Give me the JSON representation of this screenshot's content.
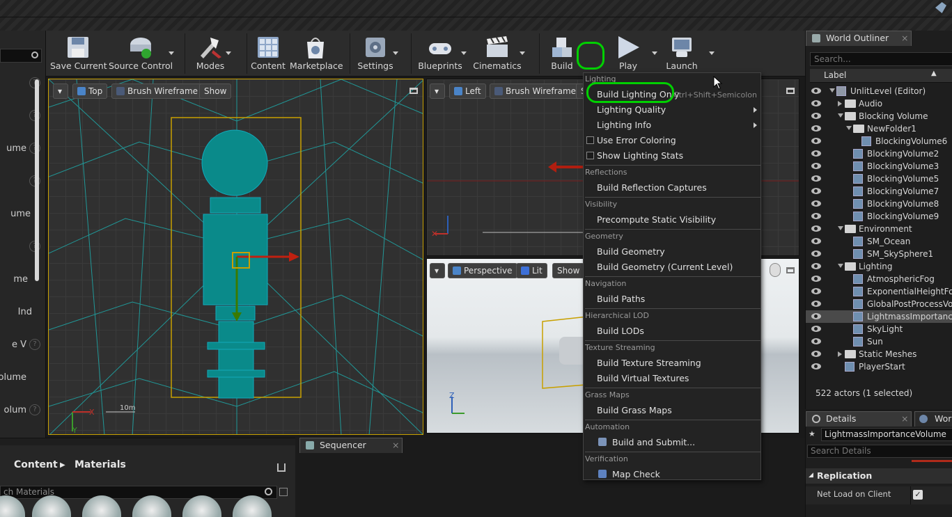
{
  "toolbar": {
    "save_current": "Save Current",
    "source_control": "Source Control",
    "modes": "Modes",
    "content": "Content",
    "marketplace": "Marketplace",
    "settings": "Settings",
    "blueprints": "Blueprints",
    "cinematics": "Cinematics",
    "build": "Build",
    "play": "Play",
    "launch": "Launch"
  },
  "left_panel": {
    "rows": [
      "ume",
      "ume",
      "me",
      "Ind",
      "e V",
      "Volume",
      "olum"
    ]
  },
  "viewport_top": {
    "view": "Top",
    "mode": "Brush Wireframe",
    "show": "Show",
    "scale": "10m"
  },
  "viewport_left": {
    "view": "Left",
    "mode": "Brush Wireframe",
    "show": "S"
  },
  "viewport_persp": {
    "view": "Perspective",
    "mode": "Lit",
    "show": "Show"
  },
  "axes": {
    "x": "X",
    "y": "Y",
    "z": "Z"
  },
  "build_menu": {
    "sections": [
      {
        "header": "Lighting",
        "items": [
          {
            "label": "Build Lighting Only",
            "shortcut": "Ctrl+Shift+Semicolon"
          },
          {
            "label": "Lighting Quality",
            "submenu": true
          },
          {
            "label": "Lighting Info",
            "submenu": true
          },
          {
            "label": "Use Error Coloring",
            "checkbox": true
          },
          {
            "label": "Show Lighting Stats",
            "checkbox": true
          }
        ]
      },
      {
        "header": "Reflections",
        "items": [
          {
            "label": "Build Reflection Captures"
          }
        ]
      },
      {
        "header": "Visibility",
        "items": [
          {
            "label": "Precompute Static Visibility"
          }
        ]
      },
      {
        "header": "Geometry",
        "items": [
          {
            "label": "Build Geometry"
          },
          {
            "label": "Build Geometry (Current Level)"
          }
        ]
      },
      {
        "header": "Navigation",
        "items": [
          {
            "label": "Build Paths"
          }
        ]
      },
      {
        "header": "Hierarchical LOD",
        "items": [
          {
            "label": "Build LODs"
          }
        ]
      },
      {
        "header": "Texture Streaming",
        "items": [
          {
            "label": "Build Texture Streaming"
          },
          {
            "label": "Build Virtual Textures"
          }
        ]
      },
      {
        "header": "Grass Maps",
        "items": [
          {
            "label": "Build Grass Maps"
          }
        ]
      },
      {
        "header": "Automation",
        "items": [
          {
            "label": "Build and Submit..."
          }
        ]
      },
      {
        "header": "Verification",
        "items": [
          {
            "label": "Map Check"
          }
        ]
      }
    ]
  },
  "outliner": {
    "title": "World Outliner",
    "search_placeholder": "Search...",
    "column": "Label",
    "rows": [
      {
        "label": "UnlitLevel (Editor)",
        "indent": 0,
        "kind": "level",
        "tri": "open"
      },
      {
        "label": "Audio",
        "indent": 1,
        "kind": "folder",
        "tri": "closed"
      },
      {
        "label": "Blocking Volume",
        "indent": 1,
        "kind": "folder",
        "tri": "open"
      },
      {
        "label": "NewFolder1",
        "indent": 2,
        "kind": "folder",
        "tri": "open"
      },
      {
        "label": "BlockingVolume6",
        "indent": 3,
        "kind": "actor"
      },
      {
        "label": "BlockingVolume2",
        "indent": 2,
        "kind": "actor"
      },
      {
        "label": "BlockingVolume3",
        "indent": 2,
        "kind": "actor"
      },
      {
        "label": "BlockingVolume5",
        "indent": 2,
        "kind": "actor"
      },
      {
        "label": "BlockingVolume7",
        "indent": 2,
        "kind": "actor"
      },
      {
        "label": "BlockingVolume8",
        "indent": 2,
        "kind": "actor"
      },
      {
        "label": "BlockingVolume9",
        "indent": 2,
        "kind": "actor"
      },
      {
        "label": "Environment",
        "indent": 1,
        "kind": "folder",
        "tri": "open"
      },
      {
        "label": "SM_Ocean",
        "indent": 2,
        "kind": "actor"
      },
      {
        "label": "SM_SkySphere1",
        "indent": 2,
        "kind": "actor"
      },
      {
        "label": "Lighting",
        "indent": 1,
        "kind": "folder",
        "tri": "open"
      },
      {
        "label": "AtmosphericFog",
        "indent": 2,
        "kind": "actor"
      },
      {
        "label": "ExponentialHeightFog",
        "indent": 2,
        "kind": "actor"
      },
      {
        "label": "GlobalPostProcessVolu",
        "indent": 2,
        "kind": "actor"
      },
      {
        "label": "LightmassImportanceV",
        "indent": 2,
        "kind": "actor",
        "selected": true
      },
      {
        "label": "SkyLight",
        "indent": 2,
        "kind": "actor"
      },
      {
        "label": "Sun",
        "indent": 2,
        "kind": "actor"
      },
      {
        "label": "Static Meshes",
        "indent": 1,
        "kind": "folder",
        "tri": "closed"
      },
      {
        "label": "PlayerStart",
        "indent": 1,
        "kind": "actor"
      }
    ],
    "status": "522 actors (1 selected)"
  },
  "details": {
    "title": "Details",
    "other_tab": "World",
    "name_value": "LightmassImportanceVolume",
    "search_placeholder": "Search Details",
    "section": "Replication",
    "property": "Net Load on Client"
  },
  "content_browser": {
    "root": "Content",
    "folder": "Materials",
    "search_placeholder": "ch Materials"
  },
  "sequencer": {
    "title": "Sequencer"
  },
  "colors": {
    "highlight": "#00d000",
    "selected_row": "#4a4a4a",
    "teal_mesh": "#008b8b"
  }
}
